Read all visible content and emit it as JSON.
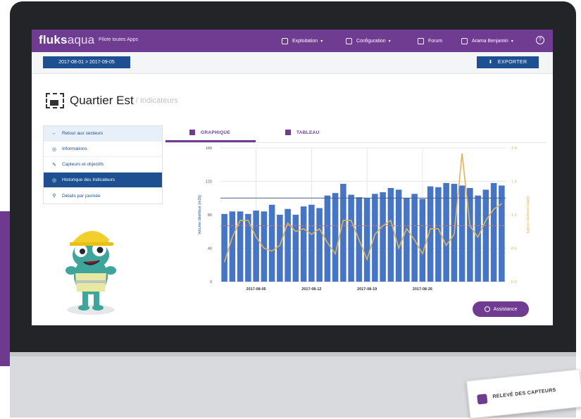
{
  "app": {
    "logo_main": "fluks",
    "logo_sub": "aqua",
    "tagline": "Pilote toutes Apps"
  },
  "nav": {
    "exploitation": "Exploitation",
    "configuration": "Configuration",
    "forum": "Forum",
    "user": "Arama Benjamin",
    "help": "?"
  },
  "toolbar": {
    "date_range": "2017-08-01 > 2017-09-05",
    "export_label": "EXPORTER"
  },
  "page": {
    "title": "Quartier Est",
    "subtitle": "/ Indicateurs"
  },
  "menu": {
    "items": [
      {
        "icon": "←",
        "label": "Retour aux secteurs"
      },
      {
        "icon": "◎",
        "label": "Informations"
      },
      {
        "icon": "✎",
        "label": "Capteurs et objectifs"
      },
      {
        "icon": "◎",
        "label": "Historique des Indicateurs"
      },
      {
        "icon": "⚲",
        "label": "Détails par journée"
      }
    ],
    "active_index": 3
  },
  "tabs": {
    "graph_label": "GRAPHIQUE",
    "table_label": "TABLEAU",
    "active": "GRAPHIQUE"
  },
  "assist_label": "Assistance",
  "card_label": "RELEVÉ DES CAPTEURS",
  "colors": {
    "brand_purple": "#6f3c91",
    "primary_blue": "#1d4f91",
    "bar_blue": "#4575c4",
    "line_yellow": "#e2b25a",
    "ref_red": "#d47a7a"
  },
  "chart_data": {
    "type": "bar",
    "ylabel": "Volume distribué (m3/j)",
    "y2label": "Débit nocturne (m3/h)",
    "ylim": [
      0,
      160
    ],
    "y2lim": [
      0,
      2.4
    ],
    "y_ticks": [
      0,
      40,
      80,
      120,
      160
    ],
    "y2_ticks": [
      0.0,
      0.6,
      1.2,
      1.8,
      2.4
    ],
    "x_tick_labels": [
      "2017-08-05",
      "2017-08-12",
      "2017-08-19",
      "2017-08-26"
    ],
    "x_tick_positions": [
      4,
      11,
      18,
      25
    ],
    "bar_values": [
      81,
      84,
      84,
      81,
      85,
      84,
      92,
      80,
      87,
      80,
      90,
      92,
      88,
      103,
      106,
      117,
      104,
      101,
      100,
      105,
      107,
      112,
      110,
      100,
      105,
      99,
      114,
      113,
      118,
      117,
      115,
      112,
      103,
      110,
      118,
      115
    ],
    "line_values": [
      0.35,
      0.8,
      1.1,
      1.1,
      0.8,
      0.6,
      0.55,
      0.65,
      1.05,
      0.9,
      0.95,
      0.85,
      0.95,
      0.7,
      0.5,
      1.1,
      1.1,
      0.75,
      0.4,
      0.85,
      1.0,
      1.1,
      0.6,
      0.95,
      0.75,
      0.5,
      0.95,
      0.95,
      0.65,
      0.85,
      2.3,
      1.0,
      0.8,
      1.1,
      1.3,
      1.4
    ],
    "reference_lines": [
      {
        "axis": "y",
        "value": 100,
        "color": "#4a5f8a"
      },
      {
        "axis": "y",
        "value": 67,
        "color": "#d47a7a"
      }
    ]
  }
}
